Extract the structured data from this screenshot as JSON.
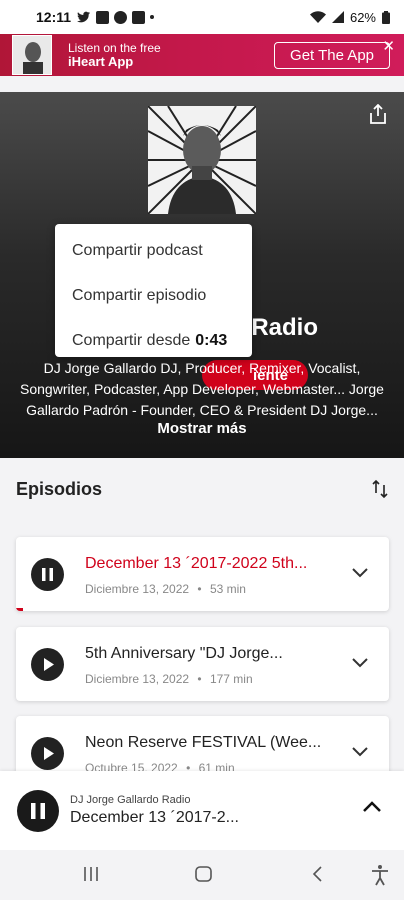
{
  "status_bar": {
    "time": "12:11",
    "battery": "62%"
  },
  "banner": {
    "line1": "Listen on the free",
    "line2": "iHeart App",
    "button": "Get The App",
    "close": "✕"
  },
  "podcast": {
    "title_visible": "o Radio",
    "follow_visible": "iente",
    "description": "DJ Jorge Gallardo DJ, Producer, Remixer, Vocalist, Songwriter, Podcaster, App Developer, Webmaster... Jorge Gallardo Padrón - Founder, CEO & President DJ Jorge...",
    "more": "Mostrar más"
  },
  "share_menu": {
    "items": [
      {
        "label": "Compartir podcast"
      },
      {
        "label": "Compartir episodio"
      },
      {
        "label": "Compartir desde",
        "time": "0:43"
      }
    ]
  },
  "episodes": {
    "heading": "Episodios",
    "list": [
      {
        "title": "December 13 ´2017-2022 5th...",
        "date": "Diciembre 13, 2022",
        "duration": "53 min",
        "playing": true
      },
      {
        "title": "5th Anniversary \"DJ Jorge...",
        "date": "Diciembre 13, 2022",
        "duration": "177 min",
        "playing": false
      },
      {
        "title": "Neon Reserve FESTIVAL (Wee...",
        "date": "Octubre 15, 2022",
        "duration": "61 min",
        "playing": false
      }
    ],
    "separator": "•"
  },
  "mini_player": {
    "podcast_name": "DJ Jorge Gallardo Radio",
    "episode_title": "December 13 ´2017-2..."
  },
  "colors": {
    "accent": "#d0021b",
    "banner": "#c3184a",
    "header_dark": "#1e1e1e"
  }
}
